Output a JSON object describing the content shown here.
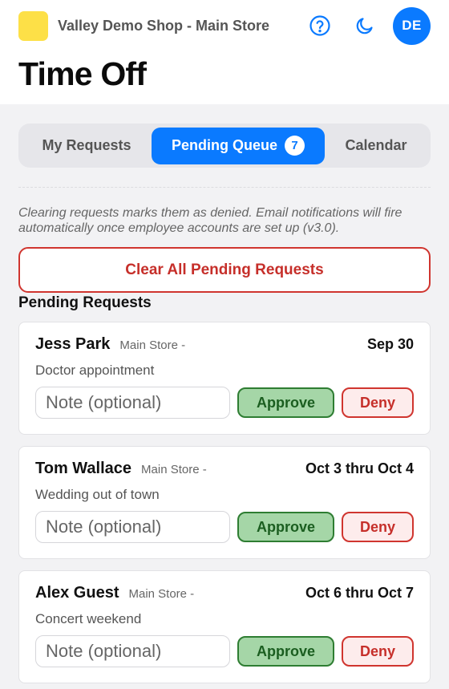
{
  "header": {
    "shop_name": "Valley Demo Shop - Main Store",
    "avatar_initials": "DE",
    "title": "Time Off",
    "icons": [
      "help-circle-icon",
      "moon-icon"
    ]
  },
  "tabs": {
    "my_requests": "My Requests",
    "pending_queue": "Pending Queue",
    "pending_count": "7",
    "calendar": "Calendar",
    "active": "pending_queue"
  },
  "notice": "Clearing requests marks them as denied. Email notifications will fire automatically once employee accounts are set up (v3.0).",
  "clear_button": "Clear All Pending Requests",
  "section_title": "Pending Requests",
  "requests": [
    {
      "name": "Jess Park",
      "store": "Main Store -",
      "dates": "Sep 30",
      "reason": "Doctor appointment",
      "note_placeholder": "Note (optional)",
      "approve_label": "Approve",
      "deny_label": "Deny"
    },
    {
      "name": "Tom Wallace",
      "store": "Main Store -",
      "dates": "Oct 3 thru Oct 4",
      "reason": "Wedding out of town",
      "note_placeholder": "Note (optional)",
      "approve_label": "Approve",
      "deny_label": "Deny"
    },
    {
      "name": "Alex Guest",
      "store": "Main Store -",
      "dates": "Oct 6 thru Oct 7",
      "reason": "Concert weekend",
      "note_placeholder": "Note (optional)",
      "approve_label": "Approve",
      "deny_label": "Deny"
    }
  ],
  "colors": {
    "accent": "#0a7aff",
    "logo": "#fde047",
    "danger": "#d0352f",
    "approve_bg": "#a5d6a7",
    "approve_border": "#2e7d32"
  }
}
